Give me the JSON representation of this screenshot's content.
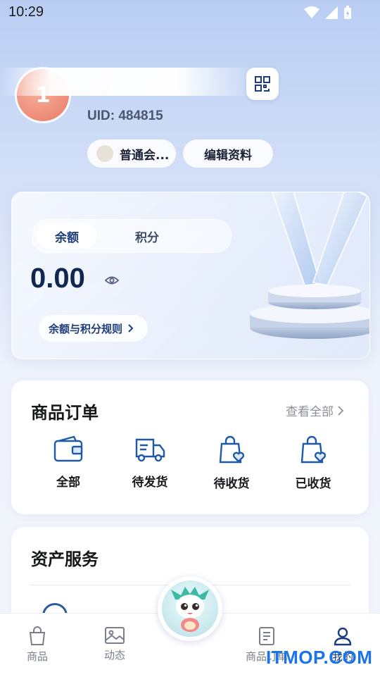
{
  "status_bar": {
    "time": "10:29"
  },
  "profile": {
    "avatar_text": "1",
    "uid": "UID: 484815",
    "member_label": "普通会...",
    "edit_label": "编辑资料"
  },
  "wallet": {
    "tabs": [
      "余额",
      "积分"
    ],
    "active_tab": "余额",
    "balance": "0.00",
    "rules_label": "余额与积分规则"
  },
  "orders": {
    "title": "商品订单",
    "view_all": "查看全部",
    "items": [
      {
        "label": "全部",
        "icon": "wallet-icon"
      },
      {
        "label": "待发货",
        "icon": "truck-icon"
      },
      {
        "label": "待收货",
        "icon": "bag-heart-icon"
      },
      {
        "label": "已收货",
        "icon": "bag-heart-icon"
      }
    ]
  },
  "assets": {
    "title": "资产服务"
  },
  "tabbar": {
    "items": [
      {
        "label": "商品",
        "icon": "shopping-bag-icon"
      },
      {
        "label": "动态",
        "icon": "image-icon"
      },
      {
        "label": "商品订单",
        "icon": "document-icon"
      },
      {
        "label": "我的",
        "icon": "user-icon"
      }
    ],
    "active": "我的"
  },
  "watermark": "ITMOP.COM",
  "colors": {
    "accent": "#1e3d7a",
    "avatar": "#ee8b76",
    "watermark": "#1a73e8"
  }
}
